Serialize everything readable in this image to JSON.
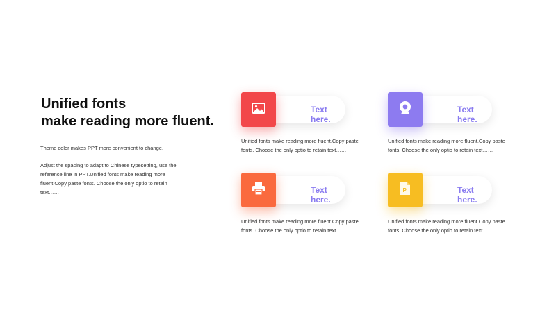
{
  "heading": {
    "line1": "Unified fonts",
    "line2": "make reading more fluent."
  },
  "intro": {
    "paragraph1": "Theme  color makes PPT more convenient to change.",
    "paragraph2": "Adjust the spacing to adapt to Chinese typesetting, use the reference line in PPT.Unified fonts make reading more fluent.Copy paste fonts. Choose the only optio to retain text……"
  },
  "cards": [
    {
      "label": "Text here.",
      "text": "Unified fonts make reading more fluent.Copy paste fonts. Choose the only optio to retain text……",
      "icon": "image-icon",
      "color": "#f2474a",
      "label_color": "#8a7cf0"
    },
    {
      "label": "Text here.",
      "text": "Unified fonts make reading more fluent.Copy paste fonts. Choose the only optio to retain text……",
      "icon": "webcam-icon",
      "color": "#8d7bf0",
      "label_color": "#8a7cf0"
    },
    {
      "label": "Text here.",
      "text": "Unified fonts make reading more fluent.Copy paste fonts. Choose the only optio to retain text……",
      "icon": "printer-icon",
      "color": "#fa6a3e",
      "label_color": "#8a7cf0"
    },
    {
      "label": "Text here.",
      "text": "Unified fonts make reading more fluent.Copy paste fonts. Choose the only optio to retain text……",
      "icon": "presentation-file-icon",
      "color": "#f7bd22",
      "label_color": "#8a7cf0"
    }
  ]
}
